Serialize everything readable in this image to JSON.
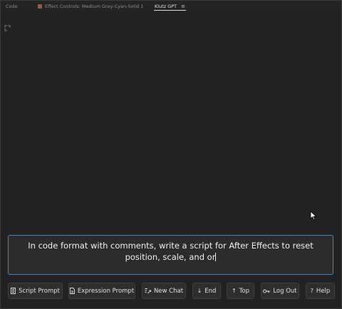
{
  "tabs": {
    "code": "Code",
    "effect_controls": "Effect Controls: Medium Grey-Cyan-Solid 1",
    "active": "Klutz GPT",
    "menu_icon": "≡"
  },
  "prompt": {
    "text": "In code format with comments, write a script for After Effects to reset position, scale, and or"
  },
  "buttons": {
    "script_prompt": "Script Prompt",
    "expression_prompt": "Expression Prompt",
    "new_chat": "New Chat",
    "end": "End",
    "top": "Top",
    "log_out": "Log Out",
    "help": "Help"
  },
  "icons": {
    "script": "document-lines-icon",
    "expression": "document-icon",
    "new_chat": "compose-icon",
    "end": "↓",
    "top": "↑",
    "log_out": "key-icon",
    "help": "?"
  },
  "colors": {
    "panel_bg": "#222222",
    "input_border": "#4a82bf",
    "button_bg": "#2e2e2e",
    "label_swatch": "#8f5b4e"
  }
}
